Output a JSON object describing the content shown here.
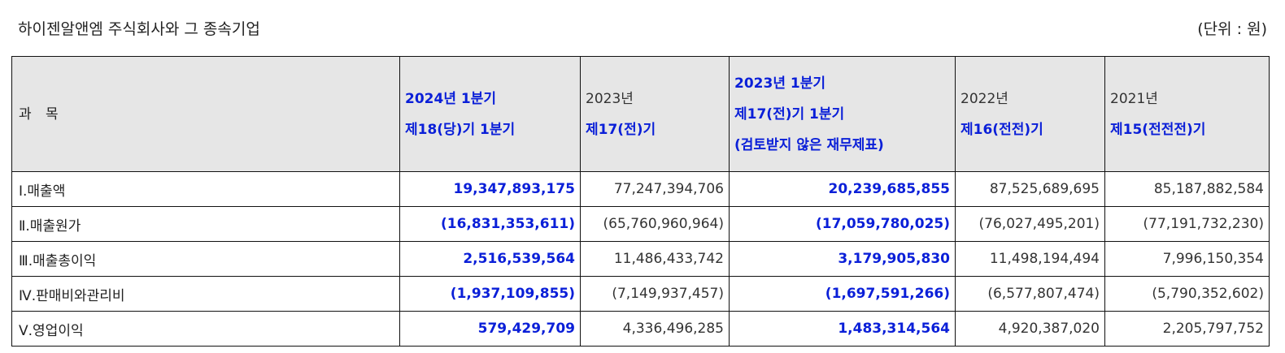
{
  "header": {
    "title": "하이젠알앤엠 주식회사와 그 종속기업",
    "unit": "(단위 : 원)"
  },
  "table": {
    "subject_header": "과 목",
    "columns": [
      {
        "line1": "2024년 1분기",
        "line2": "제18(당)기 1분기",
        "line3": "",
        "highlight": true
      },
      {
        "line1": "2023년",
        "line2": "제17(전)기",
        "line3": "",
        "highlight": false
      },
      {
        "line1": "2023년 1분기",
        "line2": "제17(전)기 1분기",
        "line3": "(검토받지 않은 재무제표)",
        "highlight": true
      },
      {
        "line1": "2022년",
        "line2": "제16(전전)기",
        "line3": "",
        "highlight": false
      },
      {
        "line1": "2021년",
        "line2": "제15(전전전)기",
        "line3": "",
        "highlight": false
      }
    ],
    "rows": [
      {
        "name": "Ⅰ.매출액",
        "values": [
          "19,347,893,175",
          "77,247,394,706",
          "20,239,685,855",
          "87,525,689,695",
          "85,187,882,584"
        ]
      },
      {
        "name": "Ⅱ.매출원가",
        "values": [
          "(16,831,353,611)",
          "(65,760,960,964)",
          "(17,059,780,025)",
          "(76,027,495,201)",
          "(77,191,732,230)"
        ]
      },
      {
        "name": "Ⅲ.매출총이익",
        "values": [
          "2,516,539,564",
          "11,486,433,742",
          "3,179,905,830",
          "11,498,194,494",
          "7,996,150,354"
        ]
      },
      {
        "name": "Ⅳ.판매비와관리비",
        "values": [
          "(1,937,109,855)",
          "(7,149,937,457)",
          "(1,697,591,266)",
          "(6,577,807,474)",
          "(5,790,352,602)"
        ]
      },
      {
        "name": "Ⅴ.영업이익",
        "values": [
          "579,429,709",
          "4,336,496,285",
          "1,483,314,564",
          "4,920,387,020",
          "2,205,797,752"
        ]
      }
    ]
  },
  "colors": {
    "highlight_text": "#0a1fd8",
    "header_bg": "#e6e6e6",
    "border": "#111111"
  }
}
